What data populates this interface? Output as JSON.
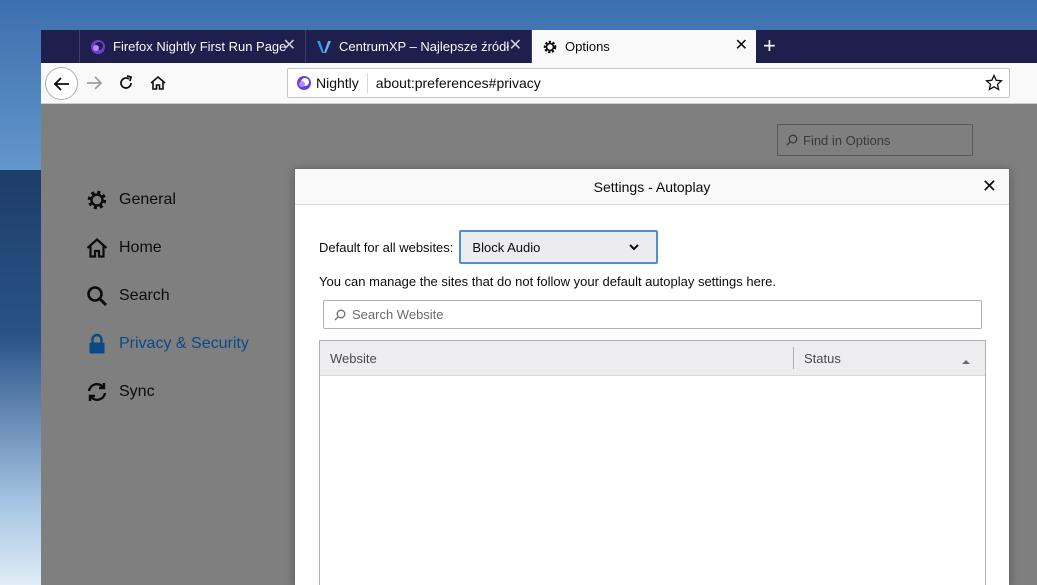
{
  "tabs": [
    {
      "title": "Firefox Nightly First Run Page",
      "icon": "nightly-logo-icon",
      "active": false
    },
    {
      "title": "CentrumXP – Najlepsze źródło",
      "icon": "centrumxp-logo-icon",
      "active": false
    },
    {
      "title": "Options",
      "icon": "gear-icon",
      "active": true
    }
  ],
  "urlbar": {
    "identity_label": "Nightly",
    "url": "about:preferences#privacy"
  },
  "find": {
    "placeholder": "Find in Options"
  },
  "categories": [
    {
      "label": "General",
      "icon": "gear-icon"
    },
    {
      "label": "Home",
      "icon": "home-icon"
    },
    {
      "label": "Search",
      "icon": "search-icon"
    },
    {
      "label": "Privacy & Security",
      "icon": "lock-icon",
      "selected": true
    },
    {
      "label": "Sync",
      "icon": "sync-icon"
    }
  ],
  "dialog": {
    "title": "Settings - Autoplay",
    "default_label": "Default for all websites:",
    "default_value": "Block Audio",
    "manage_text": "You can manage the sites that do not follow your default autoplay settings here.",
    "search_placeholder": "Search Website",
    "columns": {
      "website": "Website",
      "status": "Status"
    }
  },
  "colors": {
    "tabstrip": "#1f1f4d",
    "content_overlay": "#7f7f80",
    "selected_category": "#0a4a88",
    "select_focus": "#4a90d9"
  }
}
